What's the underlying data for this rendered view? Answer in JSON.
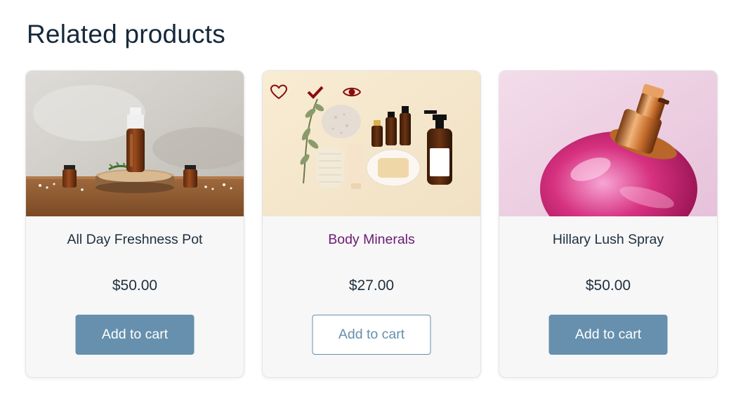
{
  "section": {
    "title": "Related products"
  },
  "products": [
    {
      "name": "All Day Freshness Pot",
      "price": "$50.00",
      "button_label": "Add to cart",
      "image_icon": "essential-oil-bottles-image"
    },
    {
      "name": "Body Minerals",
      "price": "$27.00",
      "button_label": "Add to cart",
      "image_icon": "spa-products-flatlay-image",
      "quick_actions": [
        "heart-icon",
        "check-icon",
        "eye-icon"
      ]
    },
    {
      "name": "Hillary Lush Spray",
      "price": "$50.00",
      "button_label": "Add to cart",
      "image_icon": "pink-perfume-bottle-image"
    }
  ],
  "colors": {
    "button_accent": "#6690ad",
    "hover_link": "#6b1a73",
    "quick_action_icon": "#8a0b0b",
    "card_background": "#f7f7f7",
    "title_text": "#16293a"
  }
}
